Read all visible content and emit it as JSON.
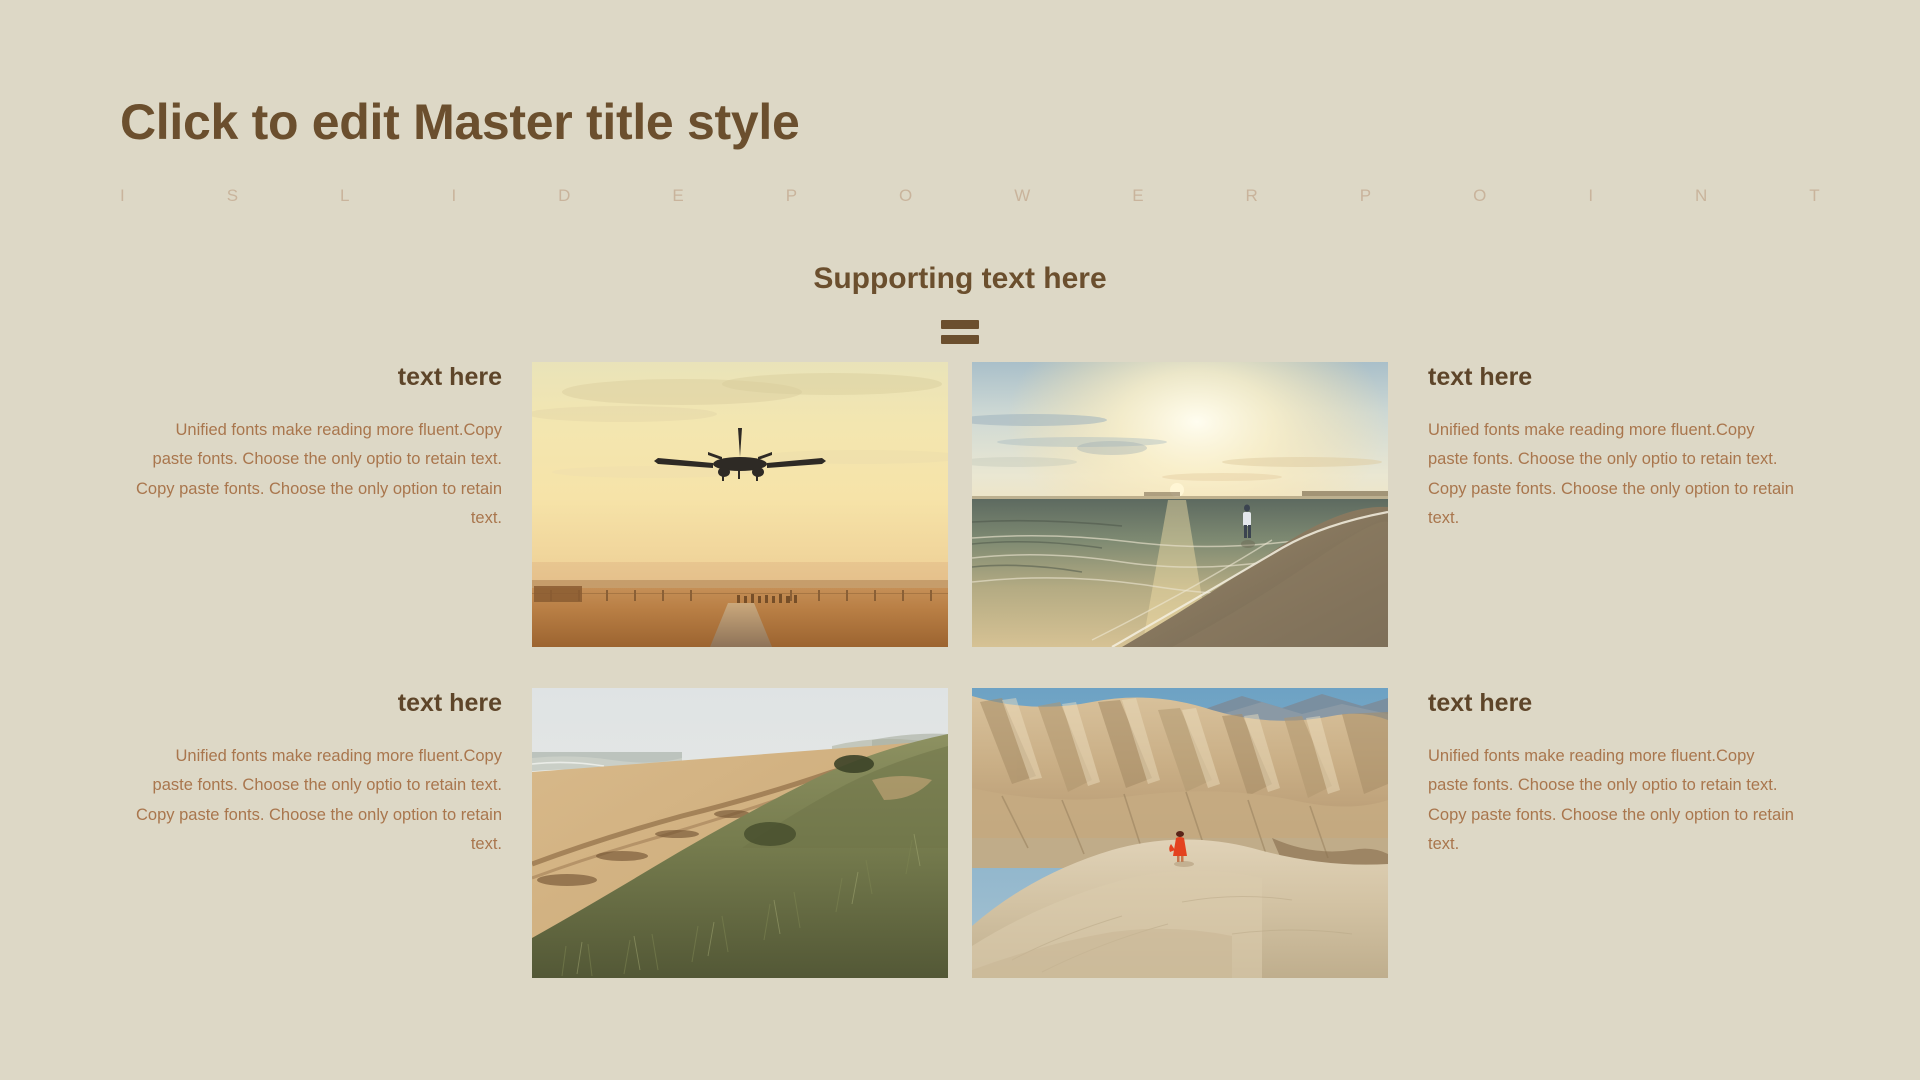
{
  "slide": {
    "background_color": "#ddd8c6",
    "title_color": "#6b4f2e",
    "body_color": "#a9764d",
    "brand_color": "#c9b49c"
  },
  "header": {
    "master_title": "Click to edit Master title style",
    "brand_strip": "ISLIDEPOWERPOINT",
    "brand_letters": [
      "I",
      "S",
      "L",
      "I",
      "D",
      "E",
      "P",
      "O",
      "W",
      "E",
      "R",
      "P",
      "O",
      "I",
      "N",
      "T"
    ]
  },
  "section": {
    "heading": "Supporting text here",
    "divider": "double-bar-divider"
  },
  "cells": [
    {
      "id": "cell-top-left",
      "align": "right",
      "title": "text here",
      "paragraphs": [
        "Unified  fonts make reading more fluent.Copy paste fonts. Choose the only optio to retain text.",
        "Copy paste  fonts. Choose the only option to retain text."
      ]
    },
    {
      "id": "cell-top-right",
      "align": "left",
      "title": "text here",
      "paragraphs": [
        "Unified  fonts make reading more fluent.Copy paste fonts. Choose the only optio to retain text.",
        "Copy paste  fonts. Choose the only option to retain text."
      ]
    },
    {
      "id": "cell-bottom-left",
      "align": "right",
      "title": "text here",
      "paragraphs": [
        "Unified  fonts make reading more fluent.Copy paste fonts. Choose the only optio to retain text.",
        "Copy paste  fonts. Choose the only option to retain text."
      ]
    },
    {
      "id": "cell-bottom-right",
      "align": "left",
      "title": "text here",
      "paragraphs": [
        "Unified  fonts make reading more fluent.Copy paste fonts. Choose the only optio to retain text.",
        "Copy paste  fonts. Choose the only option to retain text."
      ]
    }
  ],
  "photos": [
    {
      "id": "photo-airplane-landing",
      "name": "airplane-landing-at-sunset-photo",
      "description": "Airliner on final approach over a golden sunset runway field"
    },
    {
      "id": "photo-beach-sunset",
      "name": "beach-sunset-walker-photo",
      "description": "Person walking on a wet beach at sunset with shallow surf"
    },
    {
      "id": "photo-coastal-dunes",
      "name": "coastal-dunes-grass-photo",
      "description": "Grassy coastal dunes beside a wide misty sand beach"
    },
    {
      "id": "photo-desert-canyon",
      "name": "desert-badlands-photo",
      "description": "Person in a red dress standing on pale desert badland ridges"
    }
  ]
}
